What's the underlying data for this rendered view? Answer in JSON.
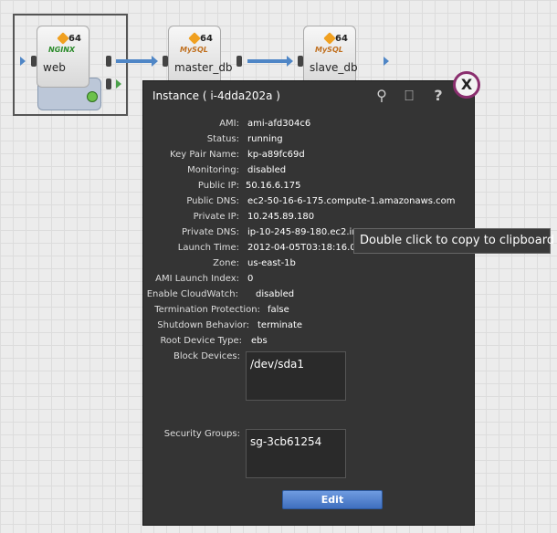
{
  "canvas": {
    "nodes": [
      {
        "label": "web",
        "bits": "64",
        "brand": "NGINX"
      },
      {
        "label": "master_db",
        "bits": "64",
        "brand": "MySQL"
      },
      {
        "label": "slave_db",
        "bits": "64",
        "brand": "MySQL"
      }
    ]
  },
  "panel": {
    "title": "Instance ( i-4dda202a )",
    "icons": [
      "pin-icon",
      "console-icon",
      "help-icon"
    ],
    "close_label": "X",
    "fields": [
      {
        "key": "AMI:",
        "value": "ami-afd304c6"
      },
      {
        "key": "Status:",
        "value": "running"
      },
      {
        "key": "Key Pair Name:",
        "value": "kp-a89fc69d"
      },
      {
        "key": "Monitoring:",
        "value": "disabled"
      },
      {
        "key": "Public IP:",
        "value": "50.16.6.175"
      },
      {
        "key": "Public DNS:",
        "value": "ec2-50-16-6-175.compute-1.amazonaws.com"
      },
      {
        "key": "Private IP:",
        "value": "10.245.89.180"
      },
      {
        "key": "Private DNS:",
        "value": "ip-10-245-89-180.ec2.inte"
      },
      {
        "key": "Launch Time:",
        "value": "2012-04-05T03:18:16.000"
      },
      {
        "key": "Zone:",
        "value": "us-east-1b"
      },
      {
        "key": "AMI Launch Index:",
        "value": "0"
      },
      {
        "key": "Enable CloudWatch:",
        "value": "disabled"
      },
      {
        "key": "Termination Protection:",
        "value": "false"
      },
      {
        "key": "Shutdown Behavior:",
        "value": "terminate"
      },
      {
        "key": "Root Device Type:",
        "value": "ebs"
      }
    ],
    "block_devices_label": "Block Devices:",
    "block_devices_value": "/dev/sda1",
    "security_groups_label": "Security Groups:",
    "security_groups_value": "sg-3cb61254",
    "edit_label": "Edit"
  },
  "tooltip": {
    "text": "Double click to copy to clipboard"
  },
  "colors": {
    "panel_bg": "#343434",
    "accent": "#4f86c6",
    "close_ring": "#8a2e6e"
  }
}
